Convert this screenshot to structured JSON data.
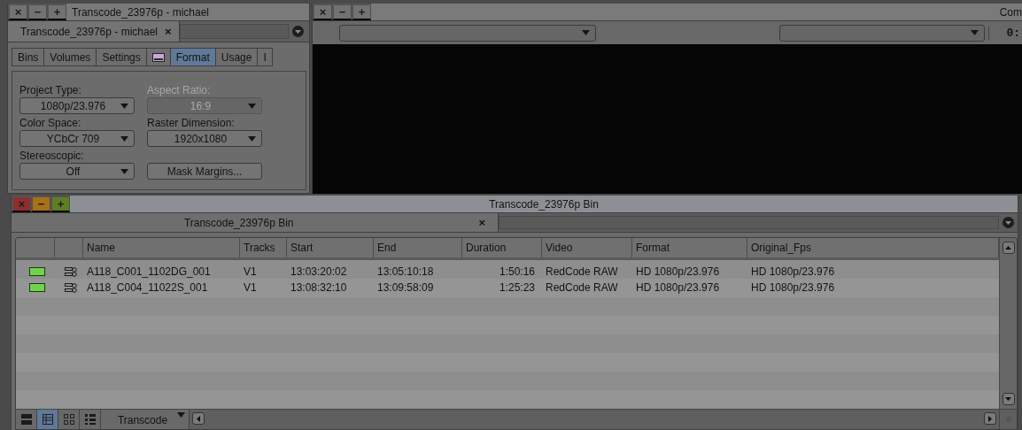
{
  "project_window": {
    "active": false,
    "title_buttons": [
      "×",
      "−",
      "+"
    ],
    "title": "Transcode_23976p - michael",
    "tab": {
      "label": "Transcode_23976p - michael",
      "close": "×"
    },
    "tabs": [
      {
        "kind": "text",
        "label": "Bins",
        "selected": false
      },
      {
        "kind": "text",
        "label": "Volumes",
        "selected": false
      },
      {
        "kind": "text",
        "label": "Settings",
        "selected": false
      },
      {
        "kind": "icon",
        "selected": false
      },
      {
        "kind": "text",
        "label": "Format",
        "selected": true
      },
      {
        "kind": "text",
        "label": "Usage",
        "selected": false
      },
      {
        "kind": "text",
        "label": "I",
        "selected": false
      }
    ],
    "fields": [
      {
        "kind": "dropdown",
        "label": "Project Type:",
        "value": "1080p/23.976",
        "disabled": false
      },
      {
        "kind": "dropdown",
        "label": "Aspect Ratio:",
        "value": "16:9",
        "disabled": true
      },
      {
        "kind": "dropdown",
        "label": "Color Space:",
        "value": "YCbCr 709",
        "disabled": false
      },
      {
        "kind": "dropdown",
        "label": "Raster Dimension:",
        "value": "1920x1080",
        "disabled": false
      },
      {
        "kind": "dropdown",
        "label": "Stereoscopic:",
        "value": "Off",
        "disabled": false
      },
      {
        "kind": "button",
        "value": "Mask Margins...",
        "disabled": false
      }
    ]
  },
  "composer": {
    "active": false,
    "title_buttons": [
      "×",
      "−",
      "+"
    ],
    "title": "Com",
    "timecode": "0:"
  },
  "bin": {
    "active": true,
    "title_buttons": [
      "×",
      "−",
      "+"
    ],
    "title": "Transcode_23976p Bin",
    "tab": {
      "label": "Transcode_23976p Bin",
      "close": "×"
    },
    "columns": [
      "Name",
      "Tracks",
      "Start",
      "End",
      "Duration",
      "Video",
      "Format",
      "Original_Fps"
    ],
    "rows": [
      {
        "cells": [
          "A118_C001_1102DG_001",
          "V1",
          "13:03:20:02",
          "13:05:10:18",
          "1:50:16",
          "RedCode RAW",
          "HD 1080p/23.976",
          "HD 1080p/23.976"
        ]
      },
      {
        "cells": [
          "A118_C004_11022S_001",
          "V1",
          "13:08:32:10",
          "13:09:58:09",
          "1:25:23",
          "RedCode RAW",
          "HD 1080p/23.976",
          "HD 1080p/23.976"
        ]
      }
    ],
    "view_buttons": [
      {
        "kind": "frame",
        "selected": false
      },
      {
        "kind": "text",
        "selected": true
      },
      {
        "kind": "thumbnail",
        "selected": false
      },
      {
        "kind": "script",
        "selected": false
      }
    ],
    "setting": "Transcode"
  }
}
